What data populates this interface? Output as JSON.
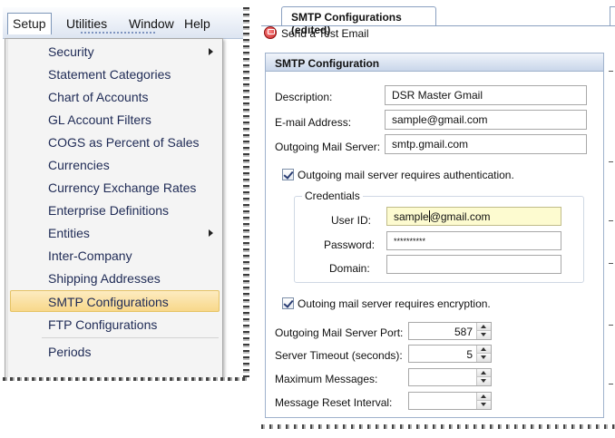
{
  "menubar": {
    "items": [
      "Setup",
      "Utilities",
      "Window",
      "Help"
    ]
  },
  "setup_menu": {
    "items": [
      {
        "label": "Security",
        "submenu": true
      },
      {
        "label": "Statement Categories",
        "submenu": false
      },
      {
        "label": "Chart of Accounts",
        "submenu": false
      },
      {
        "label": "GL Account Filters",
        "submenu": false
      },
      {
        "label": "COGS as Percent of Sales",
        "submenu": false
      },
      {
        "label": "Currencies",
        "submenu": false
      },
      {
        "label": "Currency Exchange Rates",
        "submenu": false
      },
      {
        "label": "Enterprise Definitions",
        "submenu": false
      },
      {
        "label": "Entities",
        "submenu": true
      },
      {
        "label": "Inter-Company",
        "submenu": false
      },
      {
        "label": "Shipping Addresses",
        "submenu": false
      },
      {
        "label": "SMTP Configurations",
        "submenu": false,
        "highlighted": true
      },
      {
        "label": "FTP Configurations",
        "submenu": false
      },
      {
        "label": "Periods",
        "submenu": false
      }
    ],
    "highlight_color": "#f8d88a"
  },
  "document": {
    "tab_title": "SMTP Configurations (edited)",
    "toolbar": {
      "send_test_label": "Send a Test Email",
      "send_test_icon": "email-test-icon"
    }
  },
  "smtp": {
    "section_title": "SMTP Configuration",
    "description_label": "Description:",
    "description_value": "DSR Master Gmail",
    "email_label": "E-mail Address:",
    "email_value": "sample@gmail.com",
    "server_label": "Outgoing Mail Server:",
    "server_value": "smtp.gmail.com",
    "auth_label": "Outgoing mail server requires authentication.",
    "auth_checked": true,
    "credentials": {
      "title": "Credentials",
      "userid_label": "User ID:",
      "userid_value_before_caret": "sample",
      "userid_value_after_caret": "@gmail.com",
      "password_label": "Password:",
      "password_value": "**********",
      "domain_label": "Domain:",
      "domain_value": ""
    },
    "encryption_label": "Outoing mail server requires encryption.",
    "encryption_checked": true,
    "port_label": "Outgoing Mail Server Port:",
    "port_value": "587",
    "timeout_label": "Server Timeout (seconds):",
    "timeout_value": "5",
    "max_messages_label": "Maximum Messages:",
    "max_messages_value": "",
    "reset_interval_label": "Message Reset Interval:",
    "reset_interval_value": ""
  }
}
